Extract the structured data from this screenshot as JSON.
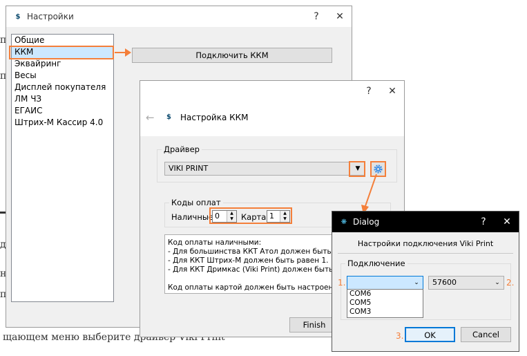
{
  "background_text": {
    "left_partial": [
      "п",
      "п",
      "д",
      "н",
      "п",
      "д"
    ],
    "bottom_line": "щающем меню выберите драйвер Viki Print"
  },
  "settings": {
    "title": "Настройки",
    "help": "?",
    "close": "✕",
    "items": [
      {
        "label": "Общие"
      },
      {
        "label": "ККМ"
      },
      {
        "label": "Эквайринг"
      },
      {
        "label": "Весы"
      },
      {
        "label": "Дисплей покупателя"
      },
      {
        "label": "ЛМ ЧЗ"
      },
      {
        "label": "ЕГАИС"
      },
      {
        "label": "Штрих-М Кассир 4.0"
      }
    ],
    "connect_button": "Подключить ККМ"
  },
  "kkm": {
    "help": "?",
    "close": "✕",
    "back": "←",
    "title": "Настройка ККМ",
    "driver_group": "Драйвер",
    "driver_value": "VIKI PRINT",
    "codes_group": "Коды оплат",
    "cash_label": "Наличные",
    "cash_value": "0",
    "card_label": "Карта",
    "card_value": "1",
    "info_lines": [
      "Код оплаты наличными:",
      "- Для большинства ККТ Атол должен быть рав",
      "- Для ККТ Штрих-М должен быть равен 1.",
      "- Для ККТ Дримкас (Viki Print) должен быть рав",
      "",
      "Код оплаты картой должен быть настроен в"
    ],
    "finish_button": "Finish"
  },
  "dialog": {
    "title": "Dialog",
    "help": "?",
    "close": "✕",
    "heading": "Настройки подключения Viki Print",
    "conn_group": "Подключение",
    "port_value": "",
    "port_options": [
      "COM6",
      "COM5",
      "COM3"
    ],
    "baud_value": "57600",
    "ok_button": "OK",
    "cancel_button": "Cancel"
  },
  "annotations": {
    "step1": "1.",
    "step2": "2.",
    "step3": "3."
  },
  "colors": {
    "highlight": "#f47f3a",
    "selection": "#cce8ff",
    "ok_border": "#0078d7"
  }
}
